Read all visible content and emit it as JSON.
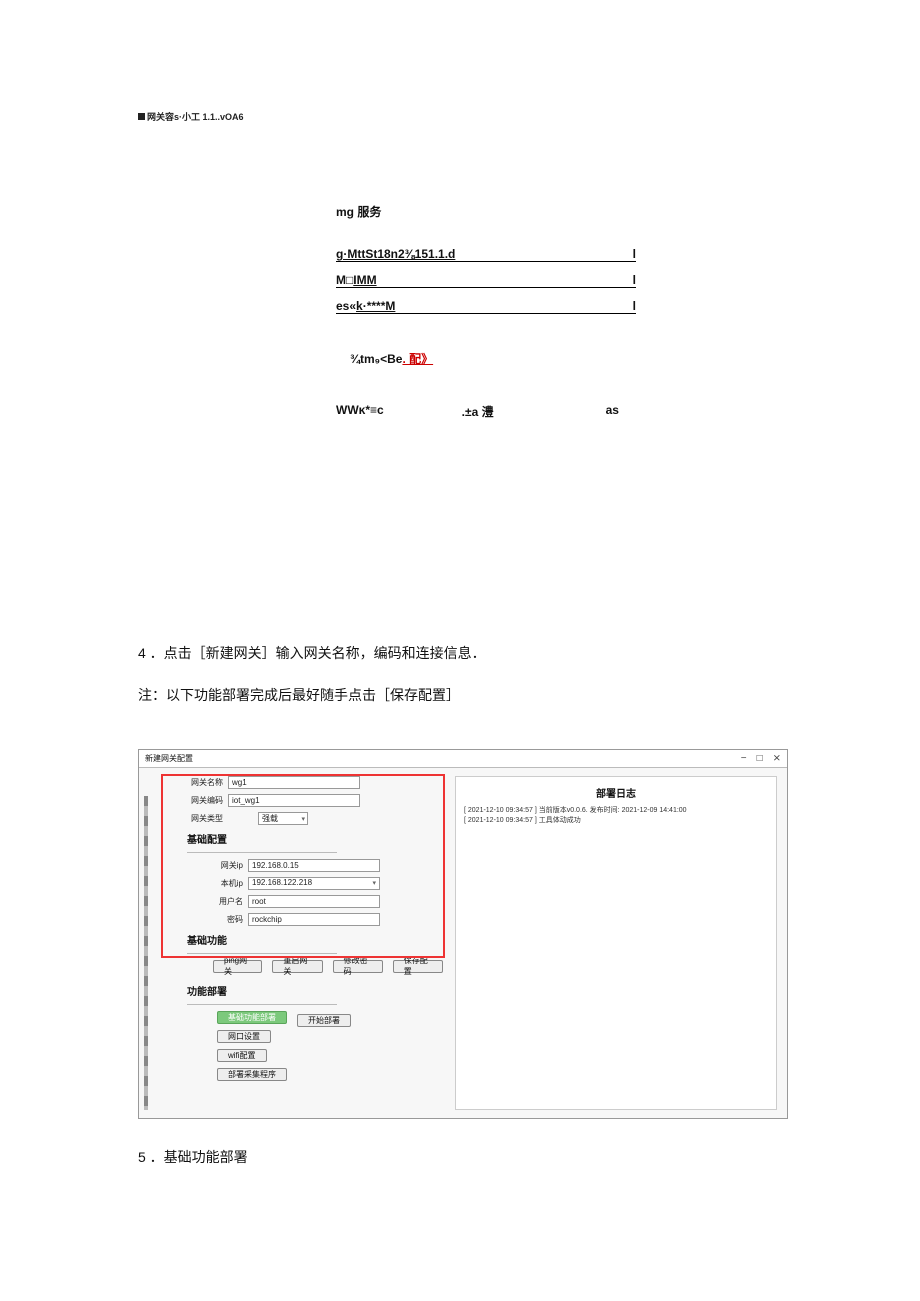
{
  "header": "网关容s·小工 1.1..vOA6",
  "upper": {
    "title": "mg 服务",
    "rows": [
      {
        "label": "g·MttSt18n2⅜151.1.d",
        "cursor": "l"
      },
      {
        "label_pre": "M□",
        "label_u": "IMM",
        "cursor": "l"
      },
      {
        "label_pre": "es«",
        "label_u": "k·****M",
        "cursor": "l"
      }
    ],
    "note_pre": "¾tm₉<Be",
    "note_red": ". 配》",
    "status": [
      "WWĸ*≡c",
      ".±a 澧",
      "as"
    ]
  },
  "body": {
    "step4": "4 ．点击［新建网关］输入网关名称，编码和连接信息．",
    "note": "注：以下功能部署完成后最好随手点击［保存配置］",
    "step5": "5 ．基础功能部署"
  },
  "shot": {
    "title": "新建网关配置",
    "window_ctrls": [
      "−",
      "□",
      "⨯"
    ],
    "fields": {
      "name_label": "网关名称",
      "name_value": "wg1",
      "code_label": "网关编码",
      "code_value": "iot_wg1",
      "type_label": "网关类型",
      "type_value": "强载",
      "ip_label": "网关ip",
      "ip_value": "192.168.0.15",
      "localip_label": "本机ip",
      "localip_value": "192.168.122.218",
      "user_label": "用户名",
      "user_value": "root",
      "pwd_label": "密码",
      "pwd_value": "rockchip"
    },
    "sections": {
      "basic_cfg": "基础配置",
      "basic_fn": "基础功能",
      "fn_deploy": "功能部署"
    },
    "buttons": {
      "ping": "ping网关",
      "restart": "重启网关",
      "chpwd": "修改密码",
      "save": "保存配置",
      "start": "开始部署",
      "basic_deploy": "基础功能部署",
      "port_cfg": "网口设置",
      "wifi_cfg": "wifi配置",
      "deploy_coll": "部署采集程序"
    },
    "right_title": "部署日志",
    "log_lines": [
      "[ 2021-12-10 09:34:57 ] 当前版本v0.0.6. 发布时间: 2021-12-09 14:41:00",
      "[ 2021-12-10 09:34:57 ] 工具体动成功"
    ]
  }
}
